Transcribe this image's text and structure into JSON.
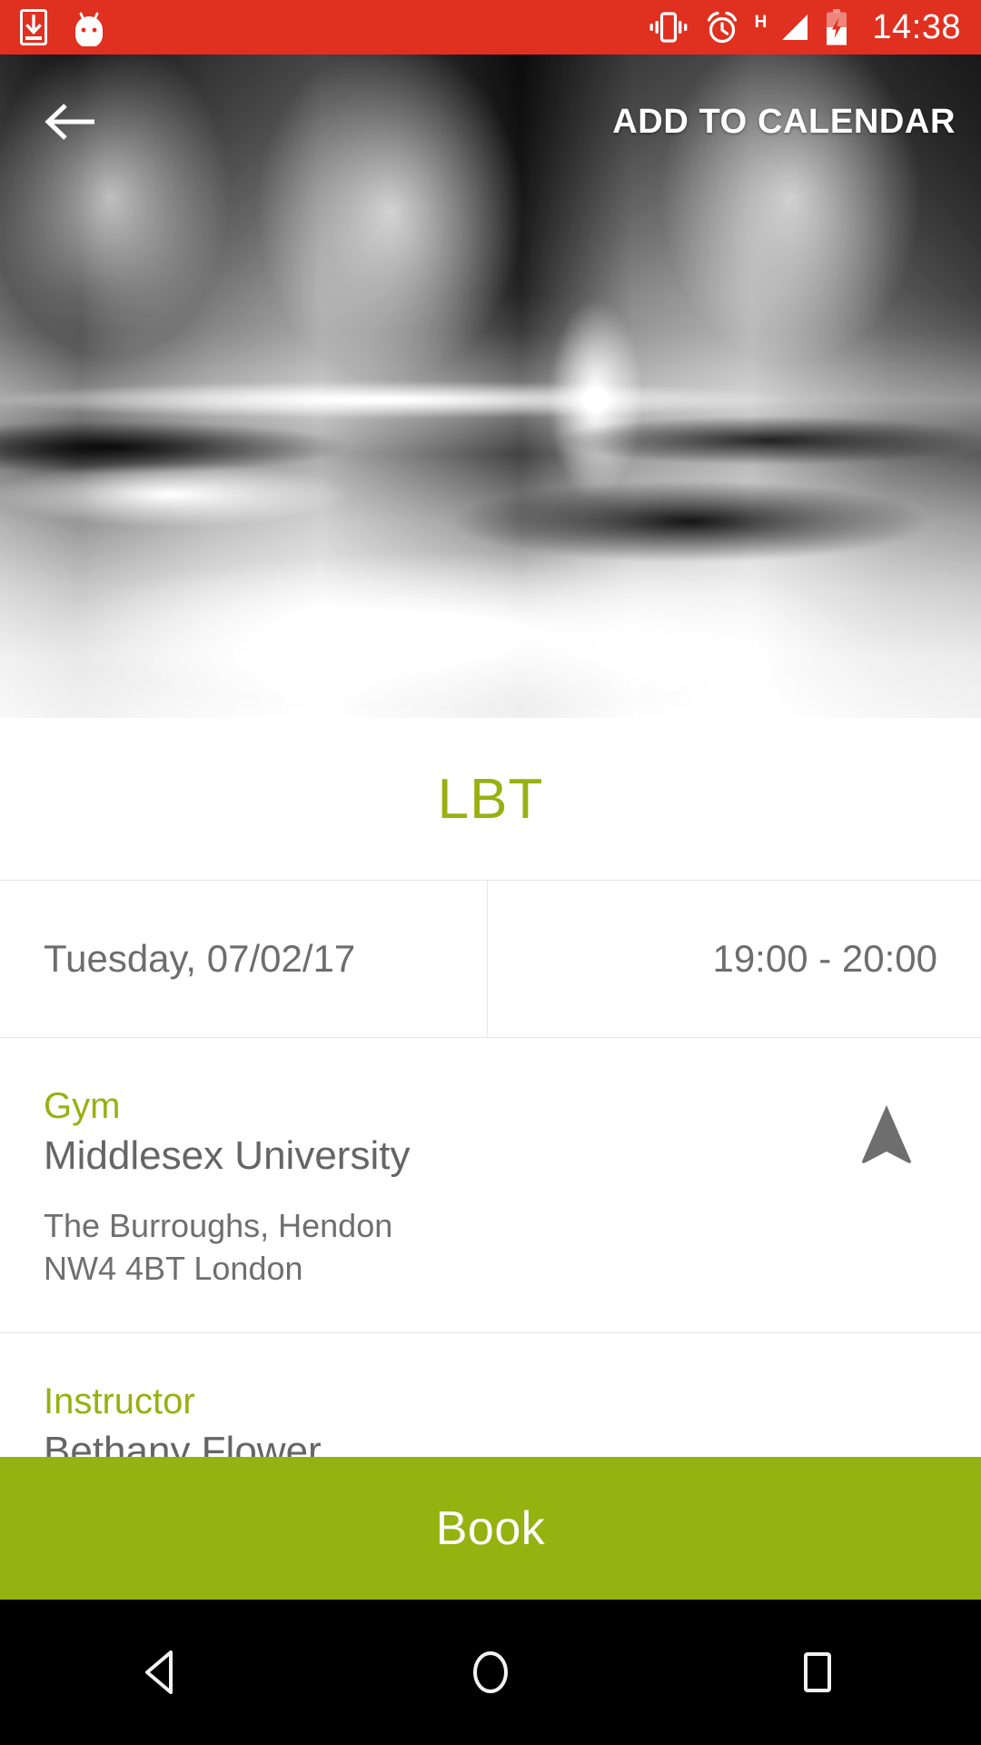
{
  "status_bar": {
    "background_color": "#E03020",
    "left_icons": [
      {
        "name": "download-icon",
        "label": "download"
      },
      {
        "name": "android-mascot-icon",
        "label": "android"
      }
    ],
    "right_icons": [
      {
        "name": "vibrate-icon",
        "label": "vibrate"
      },
      {
        "name": "alarm-clock-icon",
        "label": "alarm"
      },
      {
        "name": "signal-hspa-icon",
        "label": "H"
      },
      {
        "name": "battery-charging-icon",
        "label": "charging"
      }
    ],
    "network_type": "H",
    "clock": "14:38"
  },
  "hero": {
    "back_button_label": "Back",
    "add_to_calendar_label": "ADD TO CALENDAR",
    "image_description": "Blurred black and white photo of step aerobic benches in a gym studio"
  },
  "detail": {
    "class_title": "LBT",
    "accent_color": "#98B012",
    "schedule": {
      "date": "Tuesday, 07/02/17",
      "time": "19:00 - 20:00"
    },
    "location": {
      "label": "Gym",
      "name": "Middlesex University",
      "address_line_1": "The Burroughs, Hendon",
      "address_line_2": "NW4 4BT London",
      "directions_icon": "navigation-arrow-icon"
    },
    "instructor": {
      "label": "Instructor",
      "name": "Bethany Flower"
    }
  },
  "book_button": {
    "label": "Book",
    "color": "#94B210"
  },
  "nav_bar": {
    "buttons": [
      {
        "name": "android-back-button",
        "label": "Back"
      },
      {
        "name": "android-home-button",
        "label": "Home"
      },
      {
        "name": "android-recents-button",
        "label": "Recents"
      }
    ]
  }
}
